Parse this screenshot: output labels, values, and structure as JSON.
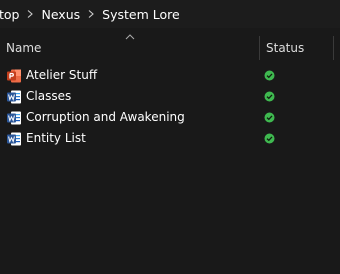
{
  "breadcrumb": {
    "items": [
      {
        "label": "top"
      },
      {
        "label": "Nexus"
      },
      {
        "label": "System Lore"
      }
    ]
  },
  "columns": {
    "name": "Name",
    "status": "Status"
  },
  "files": [
    {
      "name": "Atelier Stuff",
      "icon": "powerpoint-file-icon",
      "status": "synced-icon"
    },
    {
      "name": "Classes",
      "icon": "word-file-icon",
      "status": "synced-icon"
    },
    {
      "name": "Corruption and Awakening",
      "icon": "word-file-icon",
      "status": "synced-icon"
    },
    {
      "name": "Entity List",
      "icon": "word-file-icon",
      "status": "synced-icon"
    }
  ],
  "colors": {
    "background": "#191919",
    "powerpoint": "#c43e1c",
    "word": "#2b579a",
    "status_ok": "#3fb950"
  }
}
